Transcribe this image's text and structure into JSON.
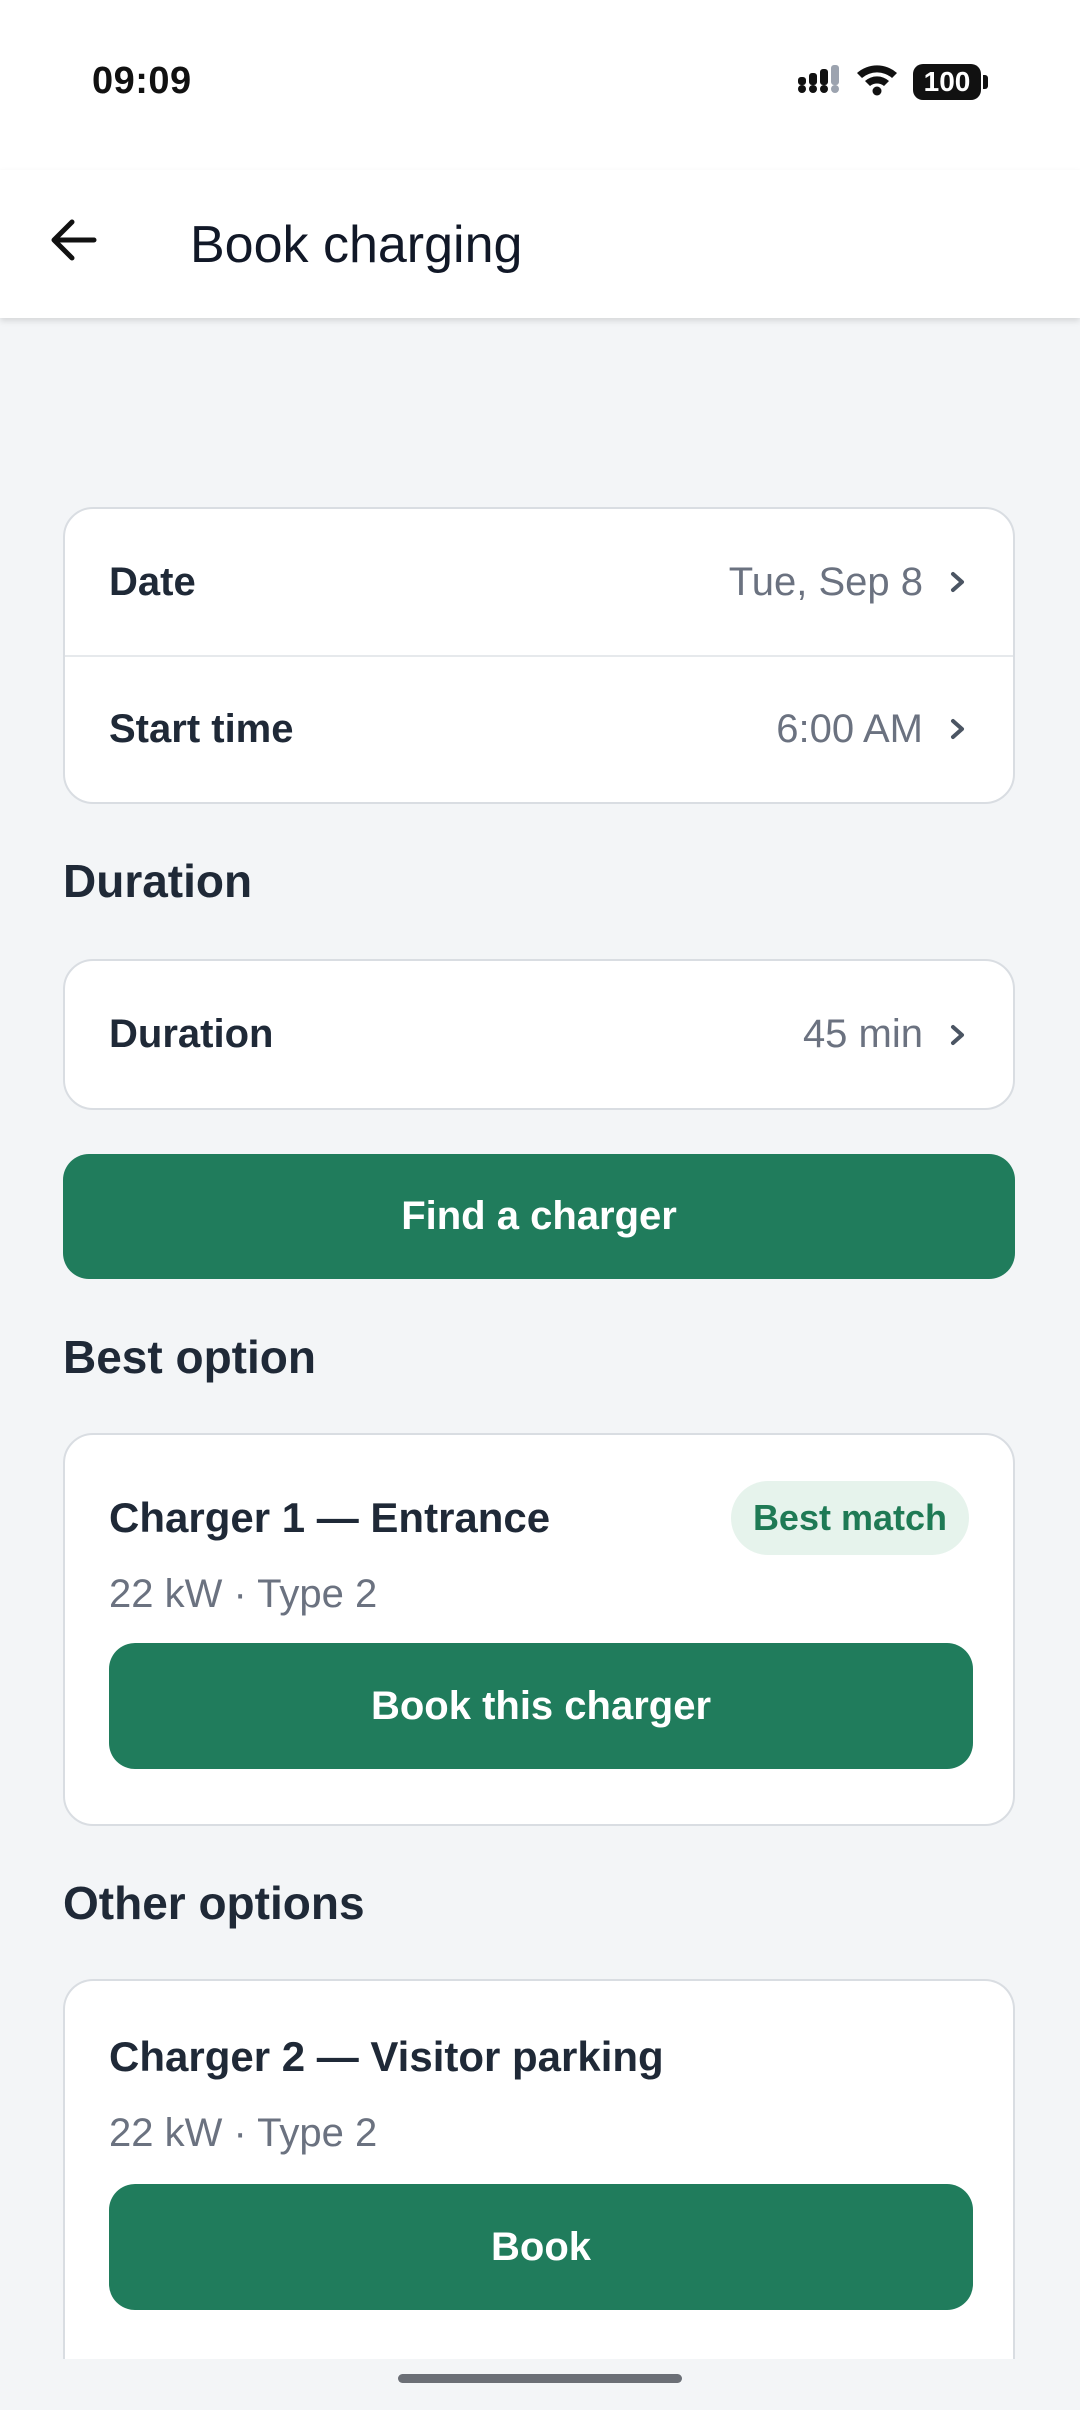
{
  "status_bar": {
    "time": "09:09",
    "battery": "100"
  },
  "header": {
    "title": "Book charging"
  },
  "schedule": {
    "date_label": "Date",
    "date_value": "Tue, Sep 8",
    "start_label": "Start time",
    "start_value": "6:00 AM"
  },
  "duration_section": {
    "title": "Duration",
    "label": "Duration",
    "value": "45 min"
  },
  "find_button": "Find a charger",
  "best_option": {
    "title": "Best option",
    "charger_name": "Charger 1 — Entrance",
    "badge": "Best match",
    "spec": "22 kW · Type 2",
    "button": "Book this charger"
  },
  "other_options": {
    "title": "Other options",
    "items": [
      {
        "charger_name": "Charger 2 — Visitor parking",
        "spec": "22 kW · Type 2",
        "button": "Book"
      }
    ]
  },
  "colors": {
    "accent": "#207c5c",
    "badge_bg": "#e6f3ec",
    "background": "#f3f5f7"
  },
  "icons": [
    "back-arrow-icon",
    "chevron-right-icon",
    "signal-icon",
    "wifi-icon",
    "battery-icon"
  ]
}
